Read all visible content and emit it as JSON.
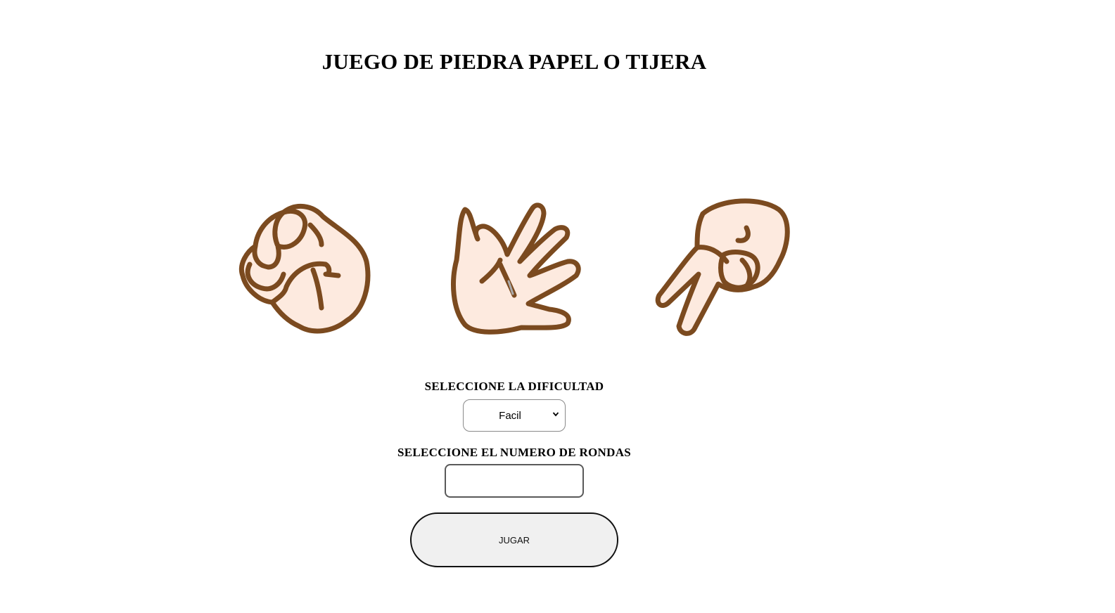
{
  "header": {
    "title": "JUEGO DE PIEDRA PAPEL O TIJERA"
  },
  "hands": [
    {
      "name": "rock",
      "icon": "rock-fist-icon"
    },
    {
      "name": "paper",
      "icon": "paper-open-hand-icon"
    },
    {
      "name": "scissors",
      "icon": "scissors-hand-icon"
    }
  ],
  "colors": {
    "skin": "#fdeadf",
    "outline": "#7b4a1f"
  },
  "form": {
    "difficulty_label": "SELECCIONE LA DIFICULTAD",
    "difficulty_selected": "Facil",
    "rounds_label": "SELECCIONE EL NUMERO DE RONDAS",
    "rounds_value": "",
    "play_label": "JUGAR"
  }
}
